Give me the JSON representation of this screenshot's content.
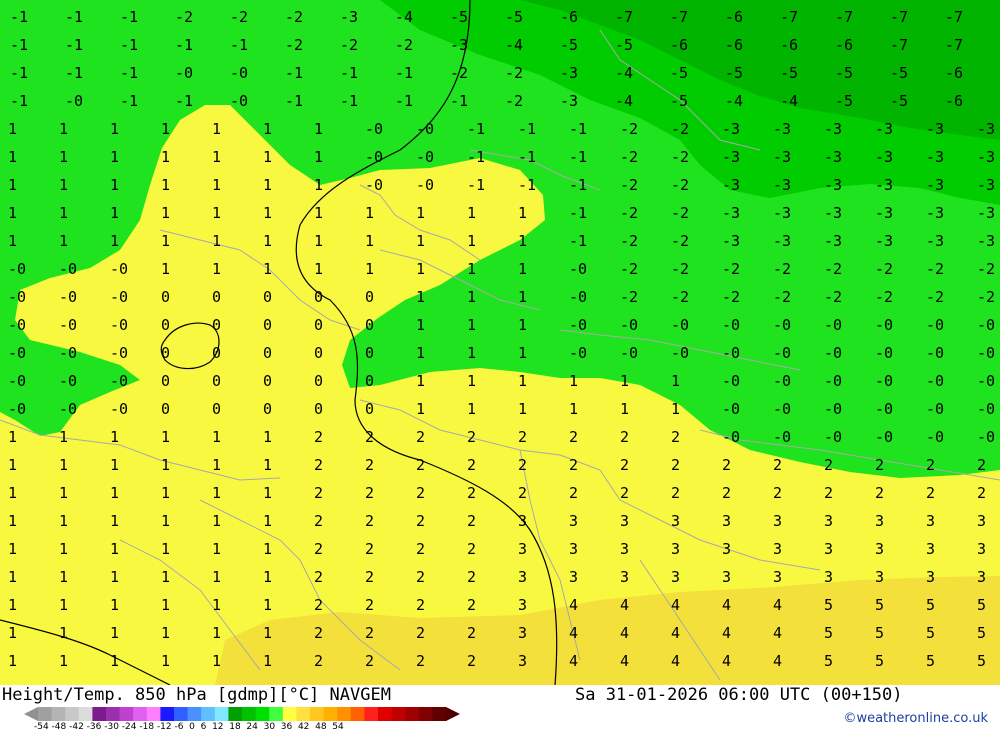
{
  "title": "Height/Temp. 850 hPa [gdmp][°C] NAVGEM",
  "valid_time": "Sa 31-01-2026 06:00 UTC (00+150)",
  "credit": "©weatheronline.co.uk",
  "colorbar": {
    "labels": "-54 -48 -42 -36 -30 -24 -18 -12 -6  0  6  12  18  24  30  36  42  48  54",
    "colors": [
      "#a0a0a0",
      "#b4b4b4",
      "#c8c8c8",
      "#dcdcdc",
      "#7d1a8c",
      "#9b2fb0",
      "#c040d0",
      "#e060f0",
      "#ff80ff",
      "#1a1aff",
      "#3060ff",
      "#4a90ff",
      "#60c0ff",
      "#7de8ff",
      "#00a000",
      "#00c000",
      "#00e000",
      "#40ff40",
      "#ffff40",
      "#ffe040",
      "#ffc820",
      "#ffb000",
      "#ff9000",
      "#ff6000",
      "#ff2020",
      "#e00000",
      "#c00000",
      "#a00000",
      "#800000",
      "#600000"
    ]
  },
  "palette": {
    "green_dark": "#00b000",
    "green": "#00cc00",
    "green_light": "#1ee31e",
    "yellow": "#f8f840",
    "yellow_dark": "#f4e03a"
  },
  "labels": [
    [
      "-1",
      -1
    ],
    [
      "-1",
      -1
    ],
    [
      "-1",
      -1
    ],
    [
      "-2",
      -2
    ],
    [
      "-2",
      -2
    ],
    [
      "-2",
      -2
    ],
    [
      "-3",
      -3
    ],
    [
      "-4",
      -4
    ],
    [
      "-5",
      -5
    ],
    [
      "-5",
      -5
    ],
    [
      "-6",
      -6
    ],
    [
      "-7",
      -7
    ],
    [
      "-7",
      -7
    ],
    [
      "-6",
      -6
    ],
    [
      "-7",
      -7
    ],
    [
      "-7",
      -7
    ],
    [
      "-7",
      -7
    ],
    [
      "-7",
      -7
    ],
    [
      "-1",
      -1
    ],
    [
      "-1",
      -1
    ],
    [
      "-1",
      -1
    ],
    [
      "-1",
      -1
    ],
    [
      "-1",
      -1
    ],
    [
      "-2",
      -2
    ],
    [
      "-2",
      -2
    ],
    [
      "-2",
      -2
    ],
    [
      "-3",
      -3
    ],
    [
      "-4",
      -4
    ],
    [
      "-5",
      -5
    ],
    [
      "-5",
      -5
    ],
    [
      "-6",
      -6
    ],
    [
      "-6",
      -6
    ],
    [
      "-6",
      -6
    ],
    [
      "-6",
      -6
    ],
    [
      "-7",
      -7
    ],
    [
      "-7",
      -7
    ],
    [
      "-1",
      -1
    ],
    [
      "-1",
      -1
    ],
    [
      "-1",
      -1
    ],
    [
      "-0",
      0
    ],
    [
      "-0",
      0
    ],
    [
      "-1",
      -1
    ],
    [
      "-1",
      -1
    ],
    [
      "-1",
      -1
    ],
    [
      "-2",
      -2
    ],
    [
      "-2",
      -2
    ],
    [
      "-3",
      -3
    ],
    [
      "-4",
      -4
    ],
    [
      "-5",
      -5
    ],
    [
      "-5",
      -5
    ],
    [
      "-5",
      -5
    ],
    [
      "-5",
      -5
    ],
    [
      "-5",
      -5
    ],
    [
      "-6",
      -6
    ],
    [
      "-1",
      -1
    ],
    [
      "-0",
      0
    ],
    [
      "-1",
      -1
    ],
    [
      "-1",
      -1
    ],
    [
      "-0",
      0
    ],
    [
      "-1",
      -1
    ],
    [
      "-1",
      -1
    ],
    [
      "-1",
      -1
    ],
    [
      "-1",
      -1
    ],
    [
      "-2",
      -2
    ],
    [
      "-3",
      -3
    ],
    [
      "-4",
      -4
    ],
    [
      "-5",
      -5
    ],
    [
      "-4",
      -4
    ],
    [
      "-4",
      -4
    ],
    [
      "-5",
      -5
    ],
    [
      "-5",
      -5
    ],
    [
      "-6",
      -6
    ]
  ],
  "zero_text": "0",
  "one_text": "1",
  "two_text": "2",
  "three_text": "3",
  "four_text": "4",
  "five_text": "5"
}
